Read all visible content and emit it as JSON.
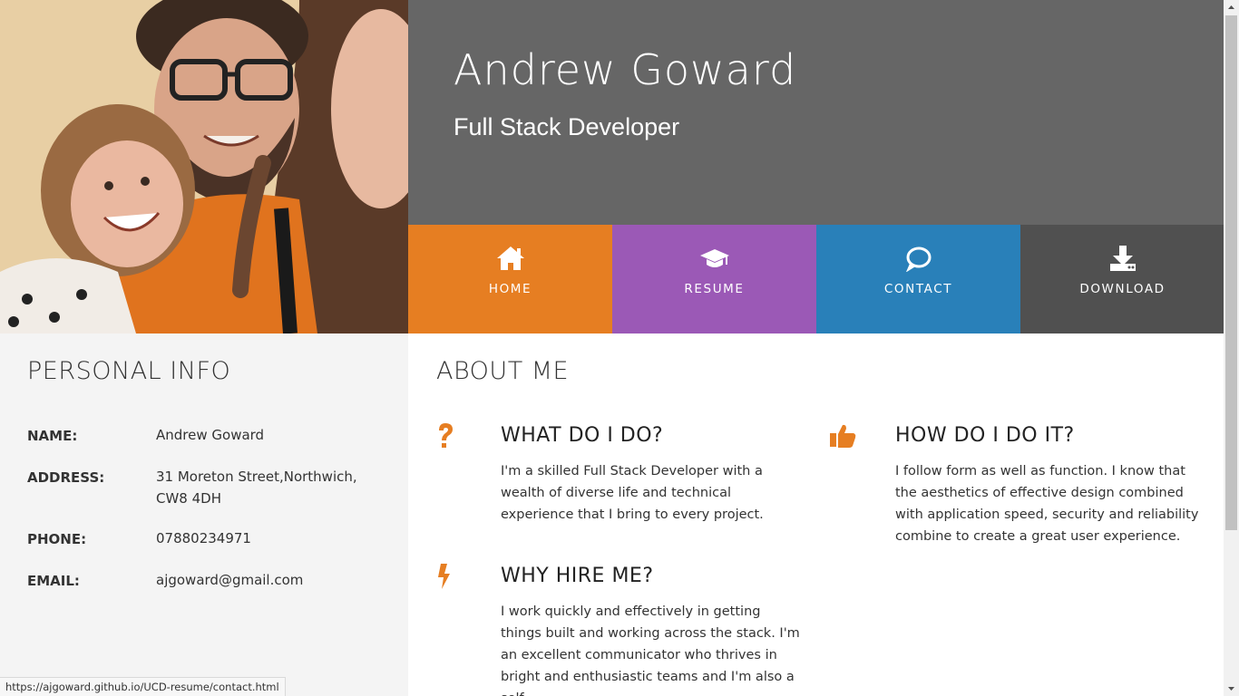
{
  "header": {
    "name": "Andrew Goward",
    "title": "Full Stack Developer",
    "photo_alt": "profile photo"
  },
  "nav": [
    {
      "label": "HOME",
      "icon": "home-icon",
      "color": "#e67e22"
    },
    {
      "label": "RESUME",
      "icon": "graduation-cap-icon",
      "color": "#9b59b6"
    },
    {
      "label": "CONTACT",
      "icon": "chat-bubble-icon",
      "color": "#2980b9"
    },
    {
      "label": "DOWNLOAD",
      "icon": "download-icon",
      "color": "#505050"
    }
  ],
  "personal": {
    "heading": "PERSONAL INFO",
    "rows": [
      {
        "label": "NAME:",
        "value": "Andrew Goward"
      },
      {
        "label": "ADDRESS:",
        "value": "31 Moreton Street,Northwich, CW8 4DH"
      },
      {
        "label": "PHONE:",
        "value": "07880234971"
      },
      {
        "label": "EMAIL:",
        "value": "ajgoward@gmail.com"
      }
    ]
  },
  "about": {
    "heading": "ABOUT ME",
    "accent": "#e67e22",
    "items": [
      {
        "icon": "question-icon",
        "title": "WHAT DO I DO?",
        "body": "I'm a skilled Full Stack Developer with a wealth of diverse life and technical experience that I bring to every project."
      },
      {
        "icon": "thumbs-up-icon",
        "title": "HOW DO I DO IT?",
        "body": "I follow form as well as function. I know that the aesthetics of effective design combined with application speed, security and reliability combine to create a great user experience."
      },
      {
        "icon": "lightning-icon",
        "title": "WHY HIRE ME?",
        "body": "I work quickly and effectively in getting things built and working across the stack. I'm an excellent communicator who thrives in bright and enthusiastic teams and I'm also a self"
      }
    ]
  },
  "status_url": "https://ajgoward.github.io/UCD-resume/contact.html"
}
